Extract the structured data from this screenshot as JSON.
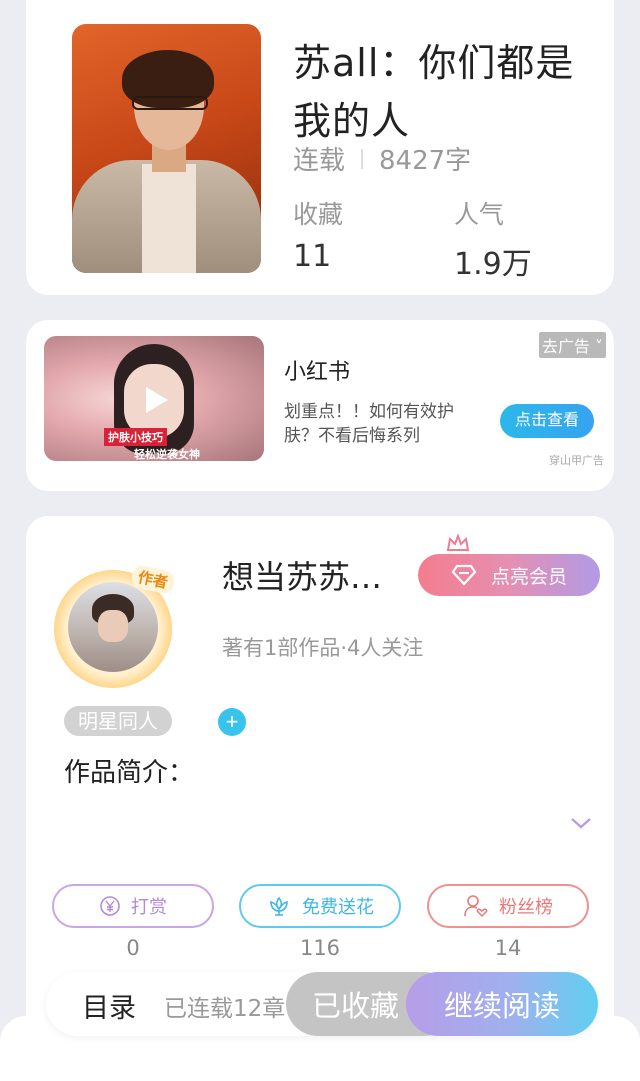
{
  "book": {
    "title": "苏all：你们都是我的人",
    "status": "连载",
    "word_count": "8427字",
    "stats": [
      {
        "label": "收藏",
        "value": "11"
      },
      {
        "label": "人气",
        "value": "1.9万"
      }
    ]
  },
  "ad": {
    "thumb_tag_1": "护肤小技巧",
    "thumb_tag_2": "轻松逆袭女神",
    "title": "小红书",
    "description": "划重点！！如何有效护肤？不看后悔系列",
    "close_label": "去广告",
    "cta_label": "点击查看",
    "source": "穿山甲广告"
  },
  "author": {
    "badge": "作者",
    "name": "想当苏苏…",
    "vip_label": "点亮会员",
    "meta": "著有1部作品·4人关注",
    "tag": "明星同人",
    "intro_label": "作品简介：",
    "actions": [
      {
        "label": "打赏",
        "count": "0",
        "icon": "yen-icon"
      },
      {
        "label": "免费送花",
        "count": "116",
        "icon": "flower-icon"
      },
      {
        "label": "粉丝榜",
        "count": "14",
        "icon": "user-heart-icon"
      }
    ]
  },
  "bottom_bar": {
    "toc_label": "目录",
    "toc_progress": "已连载12章",
    "fav_label": "已收藏",
    "read_label": "继续阅读"
  },
  "colors": {
    "accent_blue": "#37c3ec",
    "vip_gradient_start": "#f47d8d",
    "vip_gradient_end": "#b09be7",
    "read_gradient_end": "#5fcff0"
  }
}
